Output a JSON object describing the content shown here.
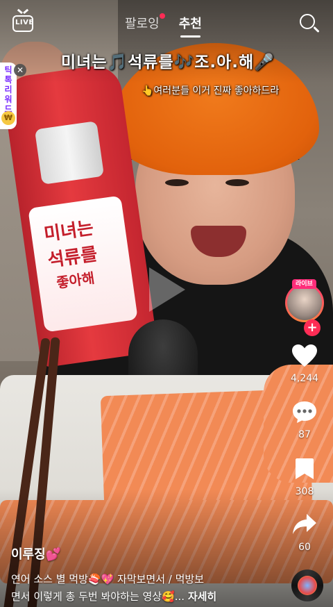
{
  "top_bar": {
    "live_label": "LIVE",
    "tabs": [
      {
        "label": "팔로잉",
        "active": false,
        "has_notification_dot": true
      },
      {
        "label": "추천",
        "active": true
      }
    ],
    "search_icon": "search-icon"
  },
  "overlay_captions": {
    "line1": "미녀는🎵석류를🎶조.아.해🎤",
    "line2": "👆여러분들 이거 진짜 좋아하드라"
  },
  "side_tag": {
    "text": "틱톡리워드",
    "close_icon": "close-icon",
    "coin_icon": "coin-icon"
  },
  "bottle_label": {
    "line1": "미녀는",
    "line2": "석류를",
    "line3": "좋아해"
  },
  "right_rail": {
    "avatar_badge": "라이브",
    "follow_icon": "plus-icon",
    "likes": "4,244",
    "comments": "87",
    "bookmarks": "308",
    "shares": "60"
  },
  "post": {
    "author": "이루징💕",
    "description_line1": "연어 소스 별 먹방🍣💖 자막보면서 / 먹방보",
    "description_line2": "면서 이렇게 총 두번 봐야하는 영상🥰...",
    "more_label": "자세히"
  },
  "colors": {
    "accent_red": "#fe2c55",
    "hat_orange": "#e2620c",
    "bottle_red": "#e53a3f"
  }
}
